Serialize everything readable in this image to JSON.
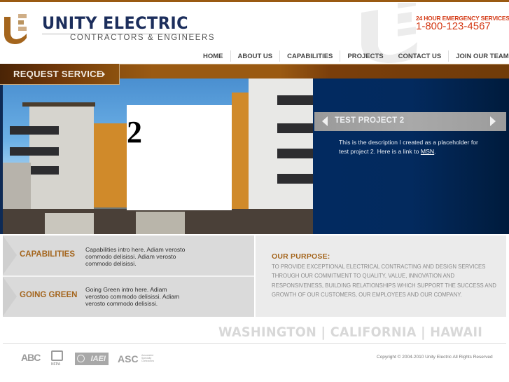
{
  "header": {
    "brand_name": "UNITY ELECTRIC",
    "brand_tagline": "CONTRACTORS & ENGINEERS",
    "emergency_label": "24 HOUR EMERGENCY SERVICES",
    "emergency_phone": "1-800-123-4567"
  },
  "nav": {
    "items": [
      {
        "label": "HOME"
      },
      {
        "label": "ABOUT US"
      },
      {
        "label": "CAPABILITIES"
      },
      {
        "label": "PROJECTS"
      },
      {
        "label": "CONTACT US"
      },
      {
        "label": "JOIN OUR TEAM"
      }
    ]
  },
  "request_service": {
    "label": "REQUEST SERVICE"
  },
  "slideshow": {
    "slide_number": "2",
    "project_title": "TEST PROJECT 2",
    "description_before_link": "This is the description I created as a placeholder for test project 2. Here is a link to ",
    "link_text": "MSN",
    "description_after_link": "."
  },
  "features": [
    {
      "title": "CAPABILITIES",
      "text": "Capabilities intro here. Adiam verosto commodo delisissi. Adiam verosto commodo delisissi."
    },
    {
      "title": "GOING GREEN",
      "text": "Going Green intro here. Adiam verostoo commodo delisissi. Adiam verosto commodo delisissi."
    }
  ],
  "purpose": {
    "title": "OUR PURPOSE:",
    "text": "TO PROVIDE EXCEPTIONAL ELECTRICAL CONTRACTING AND DESIGN SERVICES THROUGH OUR COMMITMENT TO QUALITY, VALUE, INNOVATION AND RESPONSIVENESS, BUILDING RELATIONSHIPS WHICH SUPPORT THE SUCCESS AND GROWTH OF OUR CUSTOMERS, OUR EMPLOYEES AND OUR COMPANY."
  },
  "footer": {
    "states": "WASHINGTON | CALIFORNIA | HAWAII",
    "copyright": "Copyright © 2004-2010 Unity Electric  All Rights Reserved",
    "associations": {
      "abc": "ABC",
      "nfpa": "NFPA",
      "iaei": "IAEI",
      "asc": "ASC",
      "asc_sub": "Associated Specialty Contractors"
    }
  },
  "colors": {
    "brand_navy": "#1c2e5c",
    "brand_brown": "#9a5a12",
    "accent_gold": "#a4651d",
    "emergency_red": "#d43a16",
    "panel_blue": "#032a5e"
  }
}
